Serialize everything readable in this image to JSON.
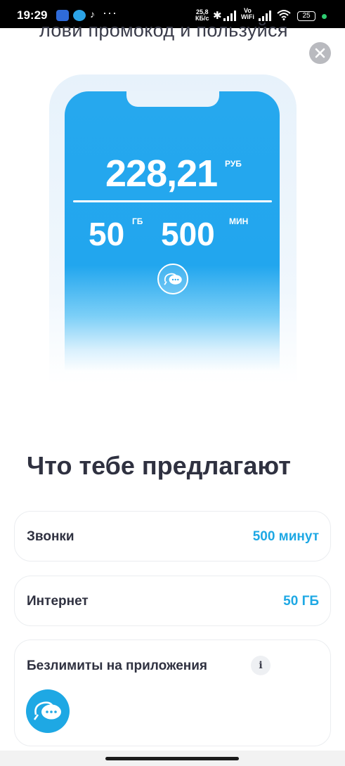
{
  "status_bar": {
    "time": "19:29",
    "network_speed_value": "25,8",
    "network_speed_unit": "КБ/с",
    "vowifi_top": "Vo",
    "vowifi_bottom": "WiFi",
    "battery": "25",
    "icons": [
      "app-icon",
      "telegram-icon",
      "tiktok-icon",
      "more-dots-icon",
      "bluetooth-icon",
      "signal-icon",
      "signal-icon",
      "wifi-icon",
      "battery-icon"
    ]
  },
  "promo": {
    "text": "лови промокод и пользуйся"
  },
  "phone_preview": {
    "price": "228,21",
    "price_unit": "РУБ",
    "data_value": "50",
    "data_unit": "ГБ",
    "minutes_value": "500",
    "minutes_unit": "МИН",
    "icon": "chat-bubbles-icon"
  },
  "offer": {
    "heading": "Что тебе предлагают",
    "items": [
      {
        "label": "Звонки",
        "value": "500 минут"
      },
      {
        "label": "Интернет",
        "value": "50 ГБ"
      },
      {
        "label": "Безлимиты на приложения",
        "info": "i",
        "icon": "chat-bubbles-icon"
      }
    ]
  },
  "colors": {
    "accent": "#1ea8e4",
    "screen_blue": "#22a6ee",
    "text_dark": "#2f3140",
    "close_bg": "#b9babf"
  }
}
